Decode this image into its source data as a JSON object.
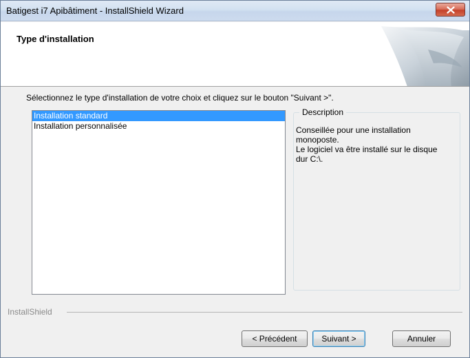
{
  "window": {
    "title": "Batigest i7 Apibâtiment - InstallShield Wizard"
  },
  "header": {
    "title": "Type d'installation"
  },
  "instruction": "Sélectionnez le type d'installation de votre choix et cliquez sur le bouton \"Suivant >\".",
  "setup_types": {
    "items": [
      {
        "label": "Installation standard",
        "selected": true
      },
      {
        "label": "Installation personnalisée",
        "selected": false
      }
    ]
  },
  "description": {
    "legend": "Description",
    "line1": "Conseillée pour une installation monoposte.",
    "line2": "Le logiciel va être installé sur le disque dur C:\\."
  },
  "brand": "InstallShield",
  "buttons": {
    "back": "< Précédent",
    "next": "Suivant >",
    "cancel": "Annuler"
  },
  "colors": {
    "selection": "#3399ff",
    "close_button": "#c4412a"
  }
}
